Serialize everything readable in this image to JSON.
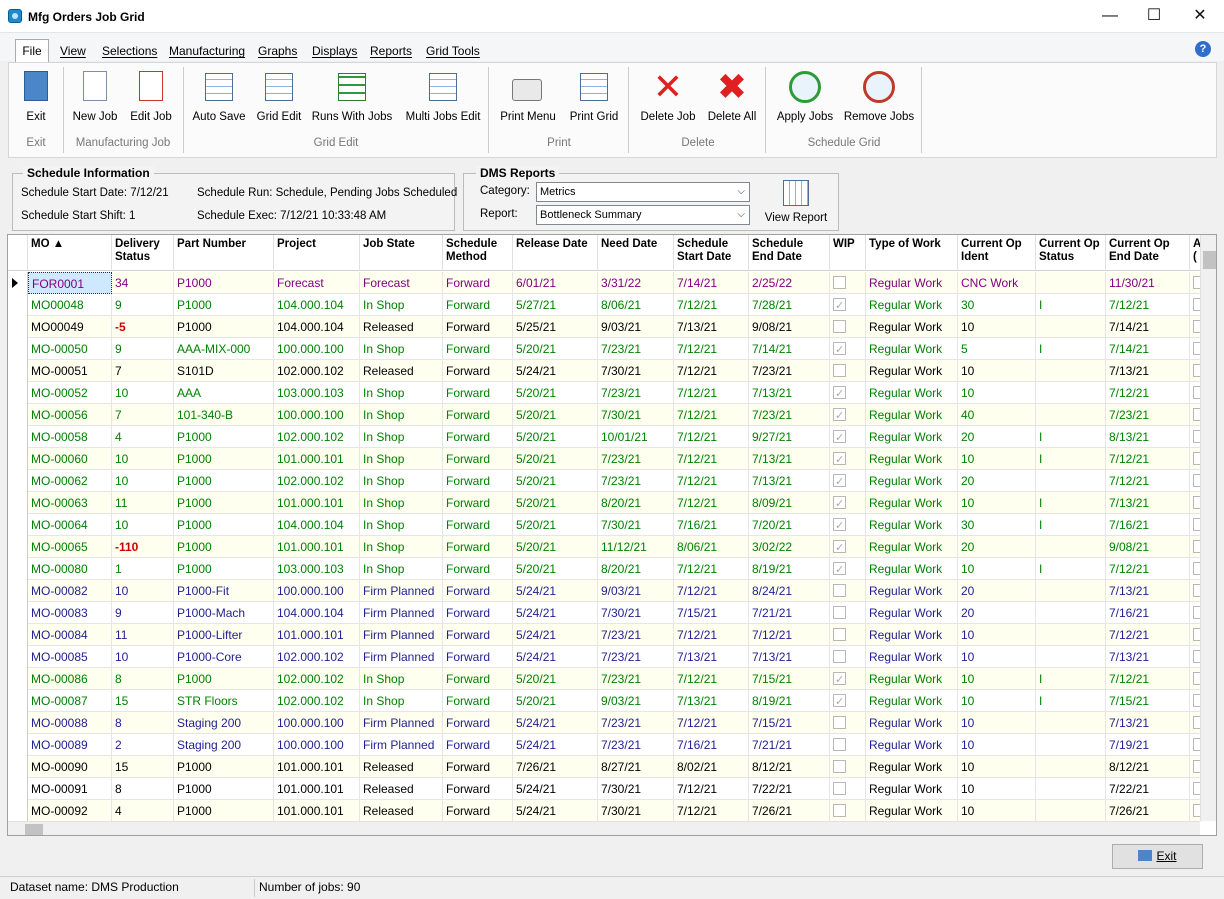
{
  "window": {
    "title": "Mfg Orders Job Grid",
    "minimize": "—",
    "maximize": "☐",
    "close": "✕"
  },
  "menu": [
    "File",
    "View",
    "Selections",
    "Manufacturing",
    "Graphs",
    "Displays",
    "Reports",
    "Grid Tools"
  ],
  "ribbon": {
    "buttons": {
      "exit": "Exit",
      "new_job": "New Job",
      "edit_job": "Edit Job",
      "auto_save": "Auto Save",
      "grid_edit": "Grid Edit",
      "runs_with_jobs": "Runs With Jobs",
      "multi_jobs_edit": "Multi Jobs Edit",
      "print_menu": "Print Menu",
      "print_grid": "Print Grid",
      "delete_job": "Delete Job",
      "delete_all": "Delete All",
      "apply_jobs": "Apply Jobs",
      "remove_jobs": "Remove Jobs"
    },
    "groups": {
      "exit": "Exit",
      "manufacturing_job": "Manufacturing Job",
      "grid_edit": "Grid Edit",
      "print": "Print",
      "delete": "Delete",
      "schedule_grid": "Schedule Grid"
    }
  },
  "schedule_info": {
    "title": "Schedule Information",
    "start_date": "Schedule Start Date: 7/12/21",
    "start_shift": "Schedule Start Shift: 1",
    "run": "Schedule Run:  Schedule, Pending Jobs Scheduled",
    "exec": "Schedule Exec:  7/12/21 10:33:48 AM"
  },
  "dms_reports": {
    "title": "DMS Reports",
    "category_label": "Category:",
    "category_value": "Metrics",
    "report_label": "Report:",
    "report_value": "Bottleneck Summary",
    "view_report": "View Report"
  },
  "grid": {
    "headers": [
      "MO ▲",
      "Delivery Status",
      "Part Number",
      "Project",
      "Job State",
      "Schedule Method",
      "Release Date",
      "Need Date",
      "Schedule Start Date",
      "Schedule End Date",
      "WIP",
      "Type of Work",
      "Current Op Ident",
      "Current Op Status",
      "Current Op End Date",
      "A ("
    ],
    "rows": [
      {
        "color": "#800080",
        "mo": "FOR0001",
        "del": "34",
        "part": "P1000",
        "proj": "Forecast",
        "state": "Forecast",
        "method": "Forward",
        "rel": "6/01/21",
        "need": "3/31/22",
        "start": "7/14/21",
        "end": "2/25/22",
        "wip": false,
        "work": "Regular Work",
        "ident": "CNC Work",
        "status": "",
        "opend": "11/30/21"
      },
      {
        "color": "#008000",
        "mo": "MO00048",
        "del": "9",
        "part": "P1000",
        "proj": "104.000.104",
        "state": "In Shop",
        "method": "Forward",
        "rel": "5/27/21",
        "need": "8/06/21",
        "start": "7/12/21",
        "end": "7/28/21",
        "wip": true,
        "work": "Regular Work",
        "ident": "30",
        "status": "I",
        "opend": "7/12/21"
      },
      {
        "color": "#000000",
        "mo": "MO00049",
        "del": "-5",
        "part": "P1000",
        "proj": "104.000.104",
        "state": "Released",
        "method": "Forward",
        "rel": "5/25/21",
        "need": "9/03/21",
        "start": "7/13/21",
        "end": "9/08/21",
        "wip": false,
        "work": "Regular Work",
        "ident": "10",
        "status": "",
        "opend": "7/14/21"
      },
      {
        "color": "#008000",
        "mo": "MO-00050",
        "del": "9",
        "part": "AAA-MIX-000",
        "proj": "100.000.100",
        "state": "In Shop",
        "method": "Forward",
        "rel": "5/20/21",
        "need": "7/23/21",
        "start": "7/12/21",
        "end": "7/14/21",
        "wip": true,
        "work": "Regular Work",
        "ident": "5",
        "status": "I",
        "opend": "7/14/21"
      },
      {
        "color": "#000000",
        "mo": "MO-00051",
        "del": "7",
        "part": "S101D",
        "proj": "102.000.102",
        "state": "Released",
        "method": "Forward",
        "rel": "5/24/21",
        "need": "7/30/21",
        "start": "7/12/21",
        "end": "7/23/21",
        "wip": false,
        "work": "Regular Work",
        "ident": "10",
        "status": "",
        "opend": "7/13/21"
      },
      {
        "color": "#008000",
        "mo": "MO-00052",
        "del": "10",
        "part": "AAA",
        "proj": "103.000.103",
        "state": "In Shop",
        "method": "Forward",
        "rel": "5/20/21",
        "need": "7/23/21",
        "start": "7/12/21",
        "end": "7/13/21",
        "wip": true,
        "work": "Regular Work",
        "ident": "10",
        "status": "",
        "opend": "7/12/21"
      },
      {
        "color": "#008000",
        "mo": "MO-00056",
        "del": "7",
        "part": "101-340-B",
        "proj": "100.000.100",
        "state": "In Shop",
        "method": "Forward",
        "rel": "5/20/21",
        "need": "7/30/21",
        "start": "7/12/21",
        "end": "7/23/21",
        "wip": true,
        "work": "Regular Work",
        "ident": "40",
        "status": "",
        "opend": "7/23/21"
      },
      {
        "color": "#008000",
        "mo": "MO-00058",
        "del": "4",
        "part": "P1000",
        "proj": "102.000.102",
        "state": "In Shop",
        "method": "Forward",
        "rel": "5/20/21",
        "need": "10/01/21",
        "start": "7/12/21",
        "end": "9/27/21",
        "wip": true,
        "work": "Regular Work",
        "ident": "20",
        "status": "I",
        "opend": "8/13/21"
      },
      {
        "color": "#008000",
        "mo": "MO-00060",
        "del": "10",
        "part": "P1000",
        "proj": "101.000.101",
        "state": "In Shop",
        "method": "Forward",
        "rel": "5/20/21",
        "need": "7/23/21",
        "start": "7/12/21",
        "end": "7/13/21",
        "wip": true,
        "work": "Regular Work",
        "ident": "10",
        "status": "I",
        "opend": "7/12/21"
      },
      {
        "color": "#008000",
        "mo": "MO-00062",
        "del": "10",
        "part": "P1000",
        "proj": "102.000.102",
        "state": "In Shop",
        "method": "Forward",
        "rel": "5/20/21",
        "need": "7/23/21",
        "start": "7/12/21",
        "end": "7/13/21",
        "wip": true,
        "work": "Regular Work",
        "ident": "20",
        "status": "",
        "opend": "7/12/21"
      },
      {
        "color": "#008000",
        "mo": "MO-00063",
        "del": "11",
        "part": "P1000",
        "proj": "101.000.101",
        "state": "In Shop",
        "method": "Forward",
        "rel": "5/20/21",
        "need": "8/20/21",
        "start": "7/12/21",
        "end": "8/09/21",
        "wip": true,
        "work": "Regular Work",
        "ident": "10",
        "status": "I",
        "opend": "7/13/21"
      },
      {
        "color": "#008000",
        "mo": "MO-00064",
        "del": "10",
        "part": "P1000",
        "proj": "104.000.104",
        "state": "In Shop",
        "method": "Forward",
        "rel": "5/20/21",
        "need": "7/30/21",
        "start": "7/16/21",
        "end": "7/20/21",
        "wip": true,
        "work": "Regular Work",
        "ident": "30",
        "status": "I",
        "opend": "7/16/21"
      },
      {
        "color": "#008000",
        "mo": "MO-00065",
        "del": "-110",
        "part": "P1000",
        "proj": "101.000.101",
        "state": "In Shop",
        "method": "Forward",
        "rel": "5/20/21",
        "need": "11/12/21",
        "start": "8/06/21",
        "end": "3/02/22",
        "wip": true,
        "work": "Regular Work",
        "ident": "20",
        "status": "",
        "opend": "9/08/21"
      },
      {
        "color": "#008000",
        "mo": "MO-00080",
        "del": "1",
        "part": "P1000",
        "proj": "103.000.103",
        "state": "In Shop",
        "method": "Forward",
        "rel": "5/20/21",
        "need": "8/20/21",
        "start": "7/12/21",
        "end": "8/19/21",
        "wip": true,
        "work": "Regular Work",
        "ident": "10",
        "status": "I",
        "opend": "7/12/21"
      },
      {
        "color": "#1f1f8f",
        "mo": "MO-00082",
        "del": "10",
        "part": "P1000-Fit",
        "proj": "100.000.100",
        "state": "Firm Planned",
        "method": "Forward",
        "rel": "5/24/21",
        "need": "9/03/21",
        "start": "7/12/21",
        "end": "8/24/21",
        "wip": false,
        "work": "Regular Work",
        "ident": "20",
        "status": "",
        "opend": "7/13/21"
      },
      {
        "color": "#1f1f8f",
        "mo": "MO-00083",
        "del": "9",
        "part": "P1000-Mach",
        "proj": "104.000.104",
        "state": "Firm Planned",
        "method": "Forward",
        "rel": "5/24/21",
        "need": "7/30/21",
        "start": "7/15/21",
        "end": "7/21/21",
        "wip": false,
        "work": "Regular Work",
        "ident": "20",
        "status": "",
        "opend": "7/16/21"
      },
      {
        "color": "#1f1f8f",
        "mo": "MO-00084",
        "del": "11",
        "part": "P1000-Lifter",
        "proj": "101.000.101",
        "state": "Firm Planned",
        "method": "Forward",
        "rel": "5/24/21",
        "need": "7/23/21",
        "start": "7/12/21",
        "end": "7/12/21",
        "wip": false,
        "work": "Regular Work",
        "ident": "10",
        "status": "",
        "opend": "7/12/21"
      },
      {
        "color": "#1f1f8f",
        "mo": "MO-00085",
        "del": "10",
        "part": "P1000-Core",
        "proj": "102.000.102",
        "state": "Firm Planned",
        "method": "Forward",
        "rel": "5/24/21",
        "need": "7/23/21",
        "start": "7/13/21",
        "end": "7/13/21",
        "wip": false,
        "work": "Regular Work",
        "ident": "10",
        "status": "",
        "opend": "7/13/21"
      },
      {
        "color": "#008000",
        "mo": "MO-00086",
        "del": "8",
        "part": "P1000",
        "proj": "102.000.102",
        "state": "In Shop",
        "method": "Forward",
        "rel": "5/20/21",
        "need": "7/23/21",
        "start": "7/12/21",
        "end": "7/15/21",
        "wip": true,
        "work": "Regular Work",
        "ident": "10",
        "status": "I",
        "opend": "7/12/21"
      },
      {
        "color": "#008000",
        "mo": "MO-00087",
        "del": "15",
        "part": "STR Floors",
        "proj": "102.000.102",
        "state": "In Shop",
        "method": "Forward",
        "rel": "5/20/21",
        "need": "9/03/21",
        "start": "7/13/21",
        "end": "8/19/21",
        "wip": true,
        "work": "Regular Work",
        "ident": "10",
        "status": "I",
        "opend": "7/15/21"
      },
      {
        "color": "#1f1f8f",
        "mo": "MO-00088",
        "del": "8",
        "part": "Staging 200",
        "proj": "100.000.100",
        "state": "Firm Planned",
        "method": "Forward",
        "rel": "5/24/21",
        "need": "7/23/21",
        "start": "7/12/21",
        "end": "7/15/21",
        "wip": false,
        "work": "Regular Work",
        "ident": "10",
        "status": "",
        "opend": "7/13/21"
      },
      {
        "color": "#1f1f8f",
        "mo": "MO-00089",
        "del": "2",
        "part": "Staging 200",
        "proj": "100.000.100",
        "state": "Firm Planned",
        "method": "Forward",
        "rel": "5/24/21",
        "need": "7/23/21",
        "start": "7/16/21",
        "end": "7/21/21",
        "wip": false,
        "work": "Regular Work",
        "ident": "10",
        "status": "",
        "opend": "7/19/21"
      },
      {
        "color": "#000000",
        "mo": "MO-00090",
        "del": "15",
        "part": "P1000",
        "proj": "101.000.101",
        "state": "Released",
        "method": "Forward",
        "rel": "7/26/21",
        "need": "8/27/21",
        "start": "8/02/21",
        "end": "8/12/21",
        "wip": false,
        "work": "Regular Work",
        "ident": "10",
        "status": "",
        "opend": "8/12/21"
      },
      {
        "color": "#000000",
        "mo": "MO-00091",
        "del": "8",
        "part": "P1000",
        "proj": "101.000.101",
        "state": "Released",
        "method": "Forward",
        "rel": "5/24/21",
        "need": "7/30/21",
        "start": "7/12/21",
        "end": "7/22/21",
        "wip": false,
        "work": "Regular Work",
        "ident": "10",
        "status": "",
        "opend": "7/22/21"
      },
      {
        "color": "#000000",
        "mo": "MO-00092",
        "del": "4",
        "part": "P1000",
        "proj": "101.000.101",
        "state": "Released",
        "method": "Forward",
        "rel": "5/24/21",
        "need": "7/30/21",
        "start": "7/12/21",
        "end": "7/26/21",
        "wip": false,
        "work": "Regular Work",
        "ident": "10",
        "status": "",
        "opend": "7/26/21"
      }
    ]
  },
  "footer": {
    "exit_button": "Exit",
    "dataset": "Dataset name:  DMS Production",
    "jobs": "Number of jobs: 90"
  },
  "colors": {
    "row_alt": "#fffff0",
    "negative": "#cc0000",
    "selected": "#cde8ff"
  }
}
